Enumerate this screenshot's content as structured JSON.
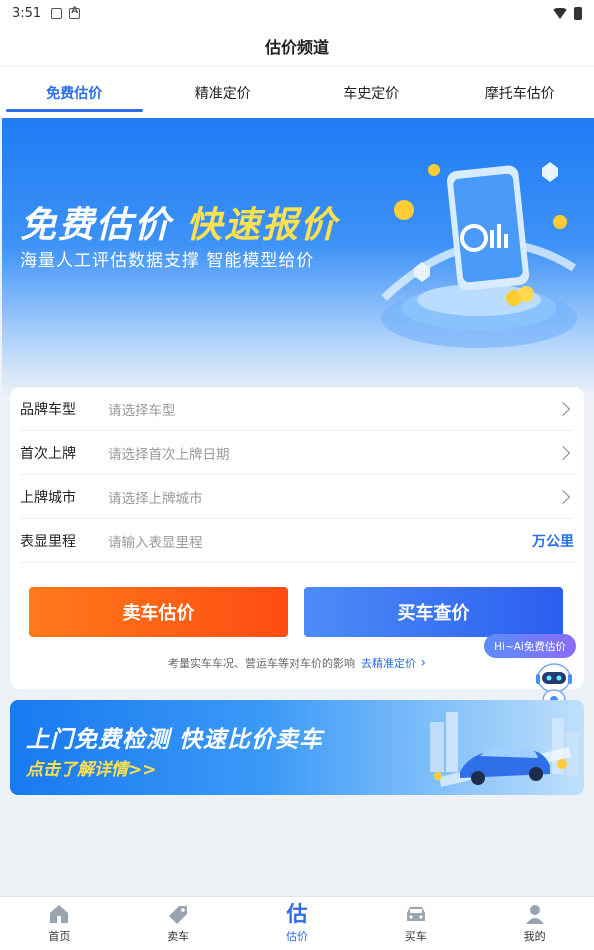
{
  "status_bar": {
    "time": "3:51"
  },
  "title": "估价频道",
  "tabs": [
    {
      "label": "免费估价",
      "active": true
    },
    {
      "label": "精准定价",
      "active": false
    },
    {
      "label": "车史定价",
      "active": false
    },
    {
      "label": "摩托车估价",
      "active": false
    }
  ],
  "hero": {
    "title_white": "免费估价",
    "title_yellow": "快速报价",
    "subtitle": "海量人工评估数据支撑 智能模型给价"
  },
  "form": {
    "rows": [
      {
        "label": "品牌车型",
        "placeholder": "请选择车型",
        "trailing": "chevron-right-icon"
      },
      {
        "label": "首次上牌",
        "placeholder": "请选择首次上牌日期",
        "trailing": "chevron-right-icon"
      },
      {
        "label": "上牌城市",
        "placeholder": "请选择上牌城市",
        "trailing": "chevron-right-icon"
      },
      {
        "label": "表显里程",
        "placeholder": "请输入表显里程",
        "unit": "万公里"
      }
    ],
    "sell_button": "卖车估价",
    "buy_button": "买车查价",
    "tip_text": "考量实车车况、营运车等对车价的影响",
    "tip_link": "去精准定价"
  },
  "ai_badge": "Hi~Ai免费估价",
  "banner2": {
    "title": "上门免费检测 快速比价卖车",
    "link": "点击了解详情>>"
  },
  "tabbar": [
    {
      "label": "首页",
      "icon": "home-icon",
      "active": false
    },
    {
      "label": "卖车",
      "icon": "sell-tag-icon",
      "active": false
    },
    {
      "label": "估价",
      "icon": "estimate-icon",
      "active": true,
      "glyph": "估"
    },
    {
      "label": "买车",
      "icon": "car-icon",
      "active": false
    },
    {
      "label": "我的",
      "icon": "profile-icon",
      "active": false
    }
  ],
  "colors": {
    "accent": "#2a6ee8",
    "sell": "#ff5a14",
    "highlight": "#ffe14d"
  }
}
